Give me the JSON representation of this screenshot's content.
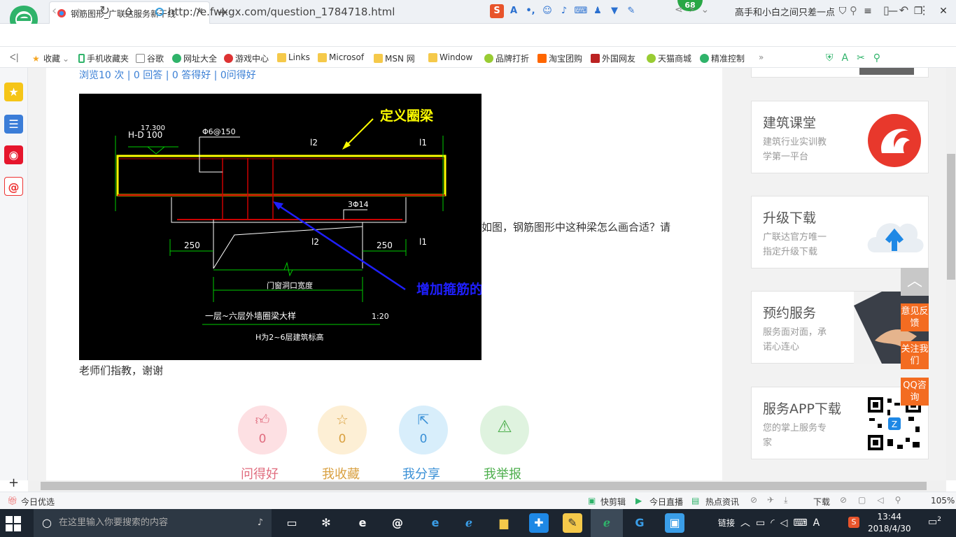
{
  "browser": {
    "tab_title": "钢筋图形_广联达服务新干线",
    "address": "http://e.fwxgx.com/question_1784718.html",
    "badge_count": "68",
    "slogan": "高手和小白之间只差一点"
  },
  "bookmarks": [
    "收藏",
    "手机收藏夹",
    "谷歌",
    "网址大全",
    "游戏中心",
    "Links",
    "Microsof",
    "MSN 网",
    "Window",
    "品牌打折",
    "淘宝团购",
    "外国网友",
    "天猫商城",
    "精准控制"
  ],
  "question": {
    "stats": "浏览10 次 | 0 回答 | 0 答得好 | 0问得好",
    "text_line1": "如图，钢筋图形中这种梁怎么画合适？请",
    "text_line2": "老师们指教，谢谢",
    "actions": [
      {
        "label": "问得好",
        "count": "0"
      },
      {
        "label": "我收藏",
        "count": "0"
      },
      {
        "label": "我分享",
        "count": "0"
      },
      {
        "label": "我举报",
        "count": ""
      }
    ]
  },
  "drawing": {
    "note_yellow": "定义圈梁",
    "note_blue": "增加箍筋的长度",
    "elev": "17.300",
    "hd": "H-D 100",
    "stirrup": "Φ6@150",
    "mark_l2": "l2",
    "mark_l1": "l1",
    "bar": "3Φ14",
    "dim_left": "250",
    "dim_right": "250",
    "opening": "门窗洞口宽度",
    "title": "一层~六层外墙圈梁大样",
    "scale": "1:20",
    "subtitle": "H为2~6层建筑标高"
  },
  "sidebar": {
    "cards": [
      {
        "title": "建筑课堂",
        "desc1": "建筑行业实训教",
        "desc2": "学第一平台"
      },
      {
        "title": "升级下载",
        "desc1": "广联达官方唯一",
        "desc2": "指定升级下载"
      },
      {
        "title": "预约服务",
        "desc1": "服务面对面，承",
        "desc2": "诺心连心"
      },
      {
        "title": "服务APP下载",
        "desc1": "您的掌上服务专",
        "desc2": "家"
      }
    ],
    "float_buttons": [
      "意见反馈",
      "关注我们",
      "QQ咨询"
    ]
  },
  "statusbar": {
    "left": "今日优选",
    "items": [
      "快剪辑",
      "今日直播",
      "热点资讯",
      "下载"
    ],
    "zoom": "105%"
  },
  "taskbar": {
    "search_placeholder": "在这里输入你要搜索的内容",
    "tray_link": "链接",
    "time": "13:44",
    "date": "2018/4/30",
    "notif": "2"
  }
}
